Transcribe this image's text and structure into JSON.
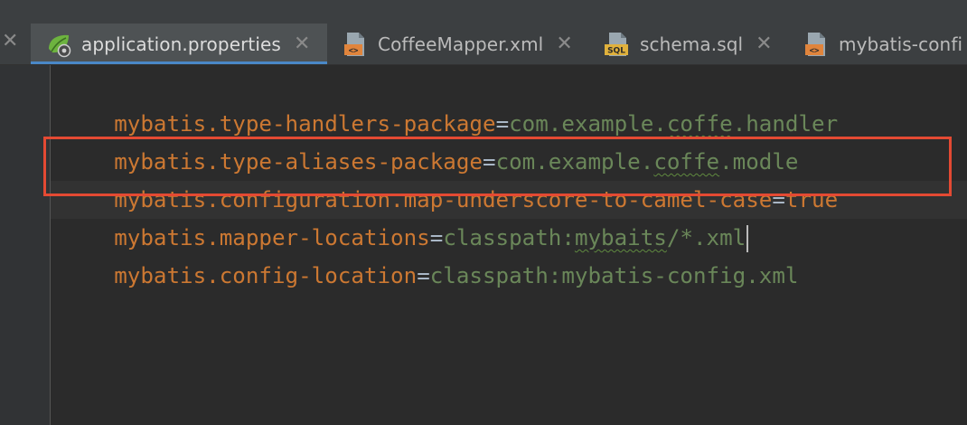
{
  "tabs": [
    {
      "label": "application.properties",
      "icon": "spring-leaf-icon",
      "active": true
    },
    {
      "label": "CoffeeMapper.xml",
      "icon": "xml-file-icon",
      "active": false
    },
    {
      "label": "schema.sql",
      "icon": "sql-file-icon",
      "active": false
    },
    {
      "label": "mybatis-confi",
      "icon": "xml-file-icon",
      "active": false
    }
  ],
  "tab_close_glyph": "✕",
  "icon_texts": {
    "xml": "<>",
    "sql": "SQL"
  },
  "code_lines": [
    {
      "key": "mybatis.type-handlers-package",
      "eq": "=",
      "value_parts": [
        "com.example.",
        "coffe",
        ".handler"
      ]
    },
    {
      "key": "mybatis.type-aliases-package",
      "eq": "=",
      "value_parts": [
        "com.example.",
        "coffe",
        ".modle"
      ]
    },
    {
      "key": "mybatis.configuration.map-underscore-to-camel-case",
      "eq": "=",
      "value": "true"
    },
    {
      "key": "mybatis.mapper-locations",
      "eq": "=",
      "value_parts": [
        "classpath:",
        "mybaits",
        "/*.xml"
      ]
    },
    {
      "key": "mybatis.config-location",
      "eq": "=",
      "value": "classpath:mybatis-config.xml"
    }
  ],
  "colors": {
    "key": "#cc7832",
    "value": "#6a8759",
    "operator": "#a9b7c6",
    "highlight_box": "#e44a33",
    "active_tab_underline": "#4a88c7",
    "editor_bg": "#2b2b2b"
  }
}
